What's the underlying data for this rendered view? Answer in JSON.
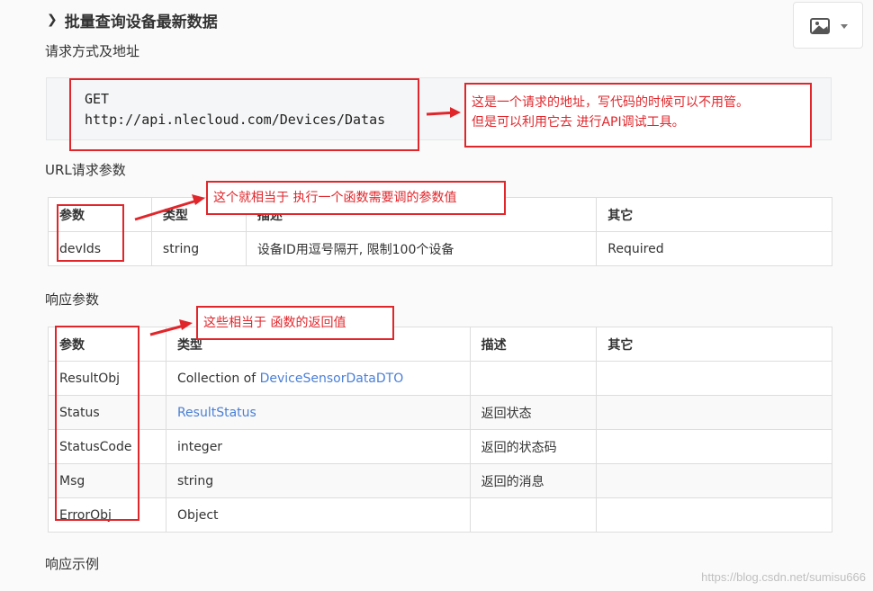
{
  "section_title": "批量查询设备最新数据",
  "request": {
    "label": "请求方式及地址",
    "method": "GET",
    "url": "http://api.nlecloud.com/Devices/Datas"
  },
  "url_params": {
    "label": "URL请求参数",
    "headers": [
      "参数",
      "类型",
      "描述",
      "其它"
    ],
    "rows": [
      [
        "devIds",
        "string",
        "设备ID用逗号隔开, 限制100个设备",
        "Required"
      ]
    ]
  },
  "response_params": {
    "label": "响应参数",
    "headers": [
      "参数",
      "类型",
      "描述",
      "其它"
    ],
    "rows": [
      {
        "name": "ResultObj",
        "type_prefix": "Collection of ",
        "type_link": "DeviceSensorDataDTO",
        "desc": "",
        "other": ""
      },
      {
        "name": "Status",
        "type_prefix": "",
        "type_link": "ResultStatus",
        "desc": "返回状态",
        "other": ""
      },
      {
        "name": "StatusCode",
        "type_prefix": "integer",
        "type_link": "",
        "desc": "返回的状态码",
        "other": ""
      },
      {
        "name": "Msg",
        "type_prefix": "string",
        "type_link": "",
        "desc": "返回的消息",
        "other": ""
      },
      {
        "name": "ErrorObj",
        "type_prefix": "Object",
        "type_link": "",
        "desc": "",
        "other": ""
      }
    ]
  },
  "response_example_label": "响应示例",
  "annotations": {
    "request_note_line1": "这是一个请求的地址，写代码的时候可以不用管。",
    "request_note_line2": "但是可以利用它去  进行API调试工具。",
    "url_params_note": "这个就相当于 执行一个函数需要调的参数值",
    "response_note": "这些相当于    函数的返回值"
  },
  "watermark": "https://blog.csdn.net/sumisu666",
  "colors": {
    "annotation_red": "#e0262b",
    "link_blue": "#4a7fd6"
  },
  "icons": {
    "image_button": "image-icon",
    "dropdown": "caret-down-icon",
    "heading": "chevron-right-icon"
  }
}
